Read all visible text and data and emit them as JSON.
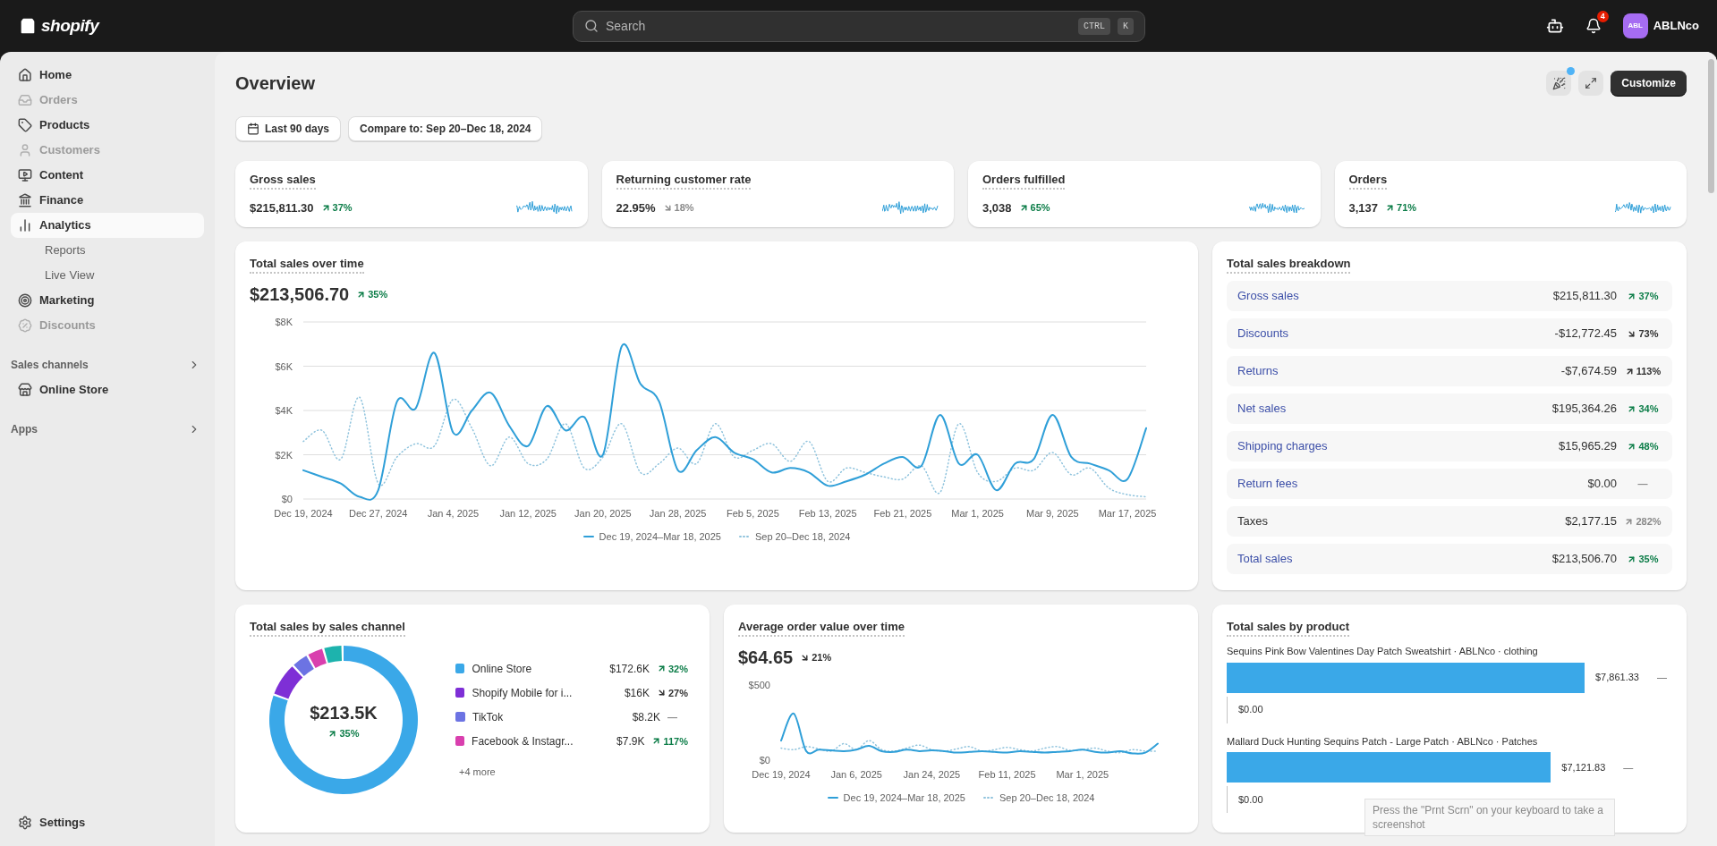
{
  "topbar": {
    "logo_text": "shopify",
    "search": {
      "placeholder": "Search",
      "shortcut": [
        "CTRL",
        "K"
      ]
    },
    "notifications_badge": "4",
    "account": {
      "initials": "ABL",
      "name": "ABLNco"
    }
  },
  "sidebar": {
    "items": [
      {
        "label": "Home",
        "disabled": false,
        "selected": false
      },
      {
        "label": "Orders",
        "disabled": true,
        "selected": false
      },
      {
        "label": "Products",
        "disabled": false,
        "selected": false
      },
      {
        "label": "Customers",
        "disabled": true,
        "selected": false
      },
      {
        "label": "Content",
        "disabled": false,
        "selected": false
      },
      {
        "label": "Finance",
        "disabled": false,
        "selected": false
      },
      {
        "label": "Analytics",
        "disabled": false,
        "selected": true,
        "children": [
          {
            "label": "Reports",
            "selected": false
          },
          {
            "label": "Live View",
            "selected": false
          }
        ]
      },
      {
        "label": "Marketing",
        "disabled": false,
        "selected": false
      },
      {
        "label": "Discounts",
        "disabled": true,
        "selected": false
      }
    ],
    "sections": [
      {
        "label": "Sales channels",
        "items": [
          {
            "label": "Online Store",
            "disabled": false,
            "selected": false
          }
        ]
      },
      {
        "label": "Apps"
      }
    ],
    "footer": {
      "label": "Settings"
    }
  },
  "page": {
    "title": "Overview",
    "whats_new_dot": true,
    "customize_label": "Customize"
  },
  "filters": [
    {
      "label": "Last 90 days",
      "kind": "date"
    },
    {
      "label": "Compare to: Sep 20–Dec 18, 2024",
      "kind": "compare"
    }
  ],
  "kpis": [
    {
      "label": "Gross sales",
      "value": "$215,811.30",
      "change": {
        "text": "37%",
        "arrow": true,
        "rising": true,
        "good": true,
        "muted": false
      }
    },
    {
      "label": "Returning customer rate",
      "value": "22.95%",
      "change": {
        "text": "18%",
        "arrow": true,
        "rising": false,
        "good": false,
        "muted": true
      }
    },
    {
      "label": "Orders fulfilled",
      "value": "3,038",
      "change": {
        "text": "65%",
        "arrow": true,
        "rising": true,
        "good": true,
        "muted": false
      }
    },
    {
      "label": "Orders",
      "value": "3,137",
      "change": {
        "text": "71%",
        "arrow": true,
        "rising": true,
        "good": true,
        "muted": false
      }
    }
  ],
  "total_sales_over_time": {
    "title": "Total sales over time",
    "value": "$213,506.70",
    "change": {
      "text": "35%",
      "arrow": true,
      "rising": true,
      "good": true,
      "muted": false
    },
    "chart_data": {
      "type": "line",
      "categories": [
        "Dec 19, 2024",
        null,
        null,
        null,
        "Dec 27, 2024",
        null,
        null,
        null,
        "Jan 4, 2025",
        null,
        null,
        null,
        "Jan 12, 2025",
        null,
        null,
        null,
        "Jan 20, 2025",
        null,
        null,
        null,
        "Jan 28, 2025",
        null,
        null,
        null,
        "Feb 5, 2025",
        null,
        null,
        null,
        "Feb 13, 2025",
        null,
        null,
        null,
        "Feb 21, 2025",
        null,
        null,
        null,
        "Mar 1, 2025",
        null,
        null,
        null,
        "Mar 9, 2025",
        null,
        null,
        null,
        "Mar 17, 2025",
        null
      ],
      "series": [
        {
          "name": "Dec 19, 2024–Mar 18, 2025",
          "color": "#2f9fd8",
          "line_style": "solid",
          "values": [
            1300,
            1000,
            700,
            100,
            400,
            4400,
            4100,
            6600,
            3000,
            4000,
            4800,
            3300,
            2400,
            4200,
            3100,
            3700,
            2000,
            6900,
            5200,
            4400,
            1300,
            2200,
            2800,
            2100,
            1800,
            1200,
            1400,
            1200,
            600,
            800,
            1100,
            1600,
            1900,
            1500,
            3800,
            1600,
            2000,
            400,
            1600,
            1800,
            3800,
            1900,
            1600,
            1300,
            900,
            3200
          ]
        },
        {
          "name": "Sep 20–Dec 18, 2024",
          "color": "#8fc3dd",
          "line_style": "dotted",
          "values": [
            2600,
            3100,
            1800,
            4600,
            700,
            1900,
            2500,
            2400,
            4500,
            3200,
            1500,
            2800,
            1600,
            1800,
            3400,
            1400,
            1900,
            3400,
            1200,
            1600,
            2300,
            1600,
            3400,
            1900,
            2200,
            2500,
            1700,
            2600,
            800,
            1400,
            1200,
            1000,
            900,
            1500,
            300,
            3400,
            1200,
            800,
            1400,
            1300,
            2100,
            1100,
            1400,
            500,
            200,
            100
          ]
        }
      ],
      "ylim": [
        0,
        8000
      ],
      "grid": true,
      "yticks": [
        {
          "value": 0,
          "label": "$0"
        },
        {
          "value": 2000,
          "label": "$2K"
        },
        {
          "value": 4000,
          "label": "$4K"
        },
        {
          "value": 6000,
          "label": "$6K"
        },
        {
          "value": 8000,
          "label": "$8K"
        }
      ]
    }
  },
  "breakdown": {
    "title": "Total sales breakdown",
    "rows": [
      {
        "label": "Gross sales",
        "link": true,
        "value": "$215,811.30",
        "change": {
          "text": "37%",
          "arrow": true,
          "rising": true,
          "good": true,
          "muted": false
        }
      },
      {
        "label": "Discounts",
        "link": true,
        "value": "-$12,772.45",
        "change": {
          "text": "73%",
          "arrow": true,
          "rising": false,
          "good": false,
          "muted": false
        }
      },
      {
        "label": "Returns",
        "link": true,
        "value": "-$7,674.59",
        "change": {
          "text": "113%",
          "arrow": true,
          "rising": true,
          "good": false,
          "muted": false
        }
      },
      {
        "label": "Net sales",
        "link": true,
        "value": "$195,364.26",
        "change": {
          "text": "34%",
          "arrow": true,
          "rising": true,
          "good": true,
          "muted": false
        }
      },
      {
        "label": "Shipping charges",
        "link": true,
        "value": "$15,965.29",
        "change": {
          "text": "48%",
          "arrow": true,
          "rising": true,
          "good": true,
          "muted": false
        }
      },
      {
        "label": "Return fees",
        "link": true,
        "value": "$0.00",
        "change": {
          "text": "—",
          "arrow": false,
          "good": false,
          "muted": true
        }
      },
      {
        "label": "Taxes",
        "link": false,
        "value": "$2,177.15",
        "change": {
          "text": "282%",
          "arrow": true,
          "rising": true,
          "good": false,
          "muted": true
        }
      },
      {
        "label": "Total sales",
        "link": true,
        "value": "$213,506.70",
        "change": {
          "text": "35%",
          "arrow": true,
          "rising": true,
          "good": true,
          "muted": false
        }
      }
    ]
  },
  "sales_by_channel": {
    "title": "Total sales by sales channel",
    "center_value": "$213.5K",
    "center_change": {
      "text": "35%",
      "arrow": true,
      "rising": true,
      "good": true,
      "muted": false
    },
    "chart_data": {
      "type": "donut",
      "categories": [
        "Online Store",
        "Shopify Mobile for i...",
        "TikTok",
        "Facebook & Instagr...",
        "+4 more"
      ],
      "values": [
        80.8,
        7.5,
        3.8,
        3.7,
        4.2
      ]
    },
    "legend": [
      {
        "kind": "row",
        "color": "#3aa8e8",
        "amount": "$172.6K",
        "change": {
          "text": "32%",
          "arrow": true,
          "rising": true,
          "good": true,
          "muted": false
        }
      },
      {
        "kind": "row",
        "color": "#7e2fd6",
        "amount": "$16K",
        "change": {
          "text": "27%",
          "arrow": true,
          "rising": false,
          "good": false,
          "muted": false
        }
      },
      {
        "kind": "row",
        "color": "#6c73e3",
        "amount": "$8.2K",
        "change": {
          "text": "—",
          "arrow": false,
          "good": false,
          "muted": true
        }
      },
      {
        "kind": "row",
        "color": "#d93fae",
        "amount": "$7.9K",
        "change": {
          "text": "117%",
          "arrow": true,
          "rising": true,
          "good": true,
          "muted": false
        }
      },
      {
        "kind": "more",
        "color": "#1db3ad"
      }
    ]
  },
  "average_order_value": {
    "title": "Average order value over time",
    "value": "$64.65",
    "change": {
      "text": "21%",
      "arrow": true,
      "rising": false,
      "good": false,
      "muted": false
    },
    "chart_data": {
      "type": "line",
      "categories": [
        "Dec 19, 2024",
        null,
        null,
        null,
        null,
        null,
        "Jan 6, 2025",
        null,
        null,
        null,
        null,
        null,
        "Jan 24, 2025",
        null,
        null,
        null,
        null,
        null,
        "Feb 11, 2025",
        null,
        null,
        null,
        null,
        null,
        "Mar 1, 2025",
        null,
        null,
        null,
        null,
        null,
        null
      ],
      "series": [
        {
          "name": "Dec 19, 2024–Mar 18, 2025",
          "color": "#2f9fd8",
          "line_style": "solid",
          "values": [
            130,
            310,
            60,
            70,
            65,
            60,
            70,
            95,
            60,
            55,
            70,
            60,
            65,
            60,
            50,
            55,
            60,
            55,
            50,
            60,
            55,
            50,
            55,
            60,
            70,
            55,
            50,
            60,
            45,
            50,
            110
          ]
        },
        {
          "name": "Sep 20–Dec 18, 2024",
          "color": "#8fc3dd",
          "line_style": "dotted",
          "values": [
            80,
            70,
            90,
            75,
            60,
            110,
            70,
            130,
            70,
            60,
            80,
            100,
            70,
            60,
            75,
            90,
            60,
            70,
            85,
            70,
            60,
            80,
            90,
            65,
            70,
            80,
            60,
            50,
            70,
            60,
            60
          ]
        }
      ],
      "ylim": [
        0,
        500
      ],
      "grid": false,
      "yticks": [
        {
          "value": 0,
          "label": "$0"
        },
        {
          "value": 500,
          "label": "$500"
        }
      ]
    }
  },
  "sales_by_product": {
    "title": "Total sales by product",
    "chart_data": {
      "type": "bar",
      "orientation": "horizontal",
      "categories": [
        "Sequins Pink Bow Valentines Day Patch Sweatshirt · ABLNco · clothing",
        "Mallard Duck Hunting Sequins Patch - Large Patch · ABLNco · Patches"
      ],
      "series": [
        {
          "color": "#3aa8e8",
          "values": [
            7861.33,
            7121.83
          ],
          "value_labels": [
            "$7,861.33",
            "$7,121.83"
          ]
        },
        {
          "color": "#c4c4c4",
          "values": [
            0,
            0
          ],
          "value_labels": [
            "$0.00",
            "$0.00"
          ]
        }
      ]
    },
    "changes": [
      "—",
      "—"
    ]
  },
  "os_tooltip": "Press the \"Prnt Scrn\" on your keyboard to take a screenshot"
}
